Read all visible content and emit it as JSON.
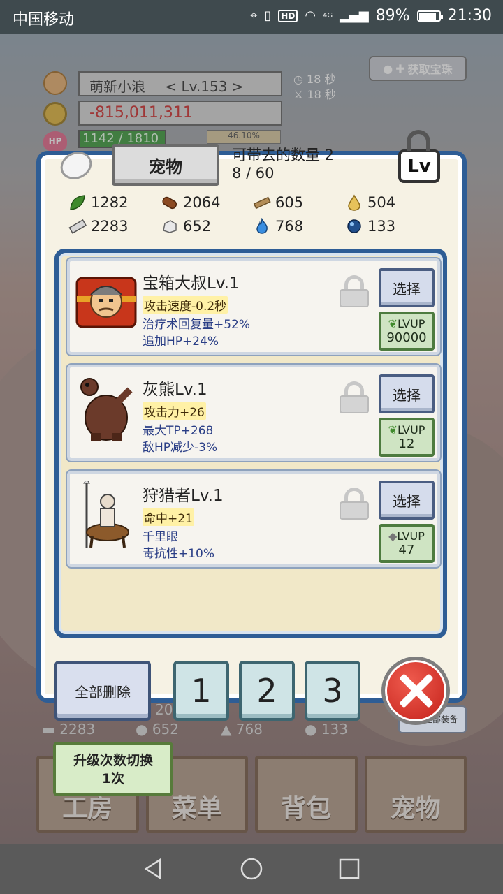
{
  "status_bar": {
    "carrier": "中国移动",
    "battery": "89%",
    "time": "21:30",
    "network": "4G",
    "hd": "HD"
  },
  "hud": {
    "player_name": "萌新小浪",
    "player_level": "< Lv.153 >",
    "gold": "-815,011,311",
    "hp": "1142 / 1810",
    "exp_percent": "46.10%",
    "timer1": "18 秒",
    "timer2": "18 秒",
    "treasure_button": "获取宝珠"
  },
  "panel": {
    "tab_label": "宠物",
    "capacity_label": "可带去的数量 2",
    "capacity_count": "8 / 60",
    "lv_button": "Lv"
  },
  "resources": [
    {
      "icon": "leaf-icon",
      "value": "1282",
      "color": "#3f8a2c"
    },
    {
      "icon": "log-icon",
      "value": "2064",
      "color": "#8b4a22"
    },
    {
      "icon": "wood-plank-icon",
      "value": "605",
      "color": "#b38d57"
    },
    {
      "icon": "oil-drop-icon",
      "value": "504",
      "color": "#e6c25a"
    },
    {
      "icon": "iron-ingot-icon",
      "value": "2283",
      "color": "#bcbcbc"
    },
    {
      "icon": "stone-icon",
      "value": "652",
      "color": "#dedede"
    },
    {
      "icon": "blue-flame-icon",
      "value": "768",
      "color": "#3a8ee0"
    },
    {
      "icon": "dark-orb-icon",
      "value": "133",
      "color": "#214f8c"
    }
  ],
  "pets": [
    {
      "name": "宝箱大叔Lv.1",
      "stat1": "攻击速度-0.2秒",
      "stat2": "治疗术回复量+52%",
      "stat3": "追加HP+24%",
      "select_label": "选择",
      "lvup_label": "LVUP",
      "lvup_cost": "90000",
      "cost_icon": "leaf-icon"
    },
    {
      "name": "灰熊Lv.1",
      "stat1": "攻击力+26",
      "stat2": "最大TP+268",
      "stat3": "敌HP减少-3%",
      "select_label": "选择",
      "lvup_label": "LVUP",
      "lvup_cost": "12",
      "cost_icon": "leaf-icon"
    },
    {
      "name": "狩猎者Lv.1",
      "stat1": "命中+21",
      "stat2": "千里眼",
      "stat3": "毒抗性+10%",
      "select_label": "选择",
      "lvup_label": "LVUP",
      "lvup_cost": "47",
      "cost_icon": "stone-icon"
    }
  ],
  "bottom_controls": {
    "delete_all": "全部删除",
    "page1": "1",
    "page2": "2",
    "page3": "3",
    "upgrade_toggle_line1": "升级次数切换",
    "upgrade_toggle_line2": "1次",
    "remove_equip": "卸下全部装备"
  },
  "bottom_resources": {
    "ingot": "2283",
    "stone": "652",
    "flame": "768",
    "orb": "133",
    "partial": "20"
  },
  "bottom_nav": {
    "workshop": "工房",
    "menu": "菜单",
    "bag": "背包",
    "pet": "宠物"
  }
}
